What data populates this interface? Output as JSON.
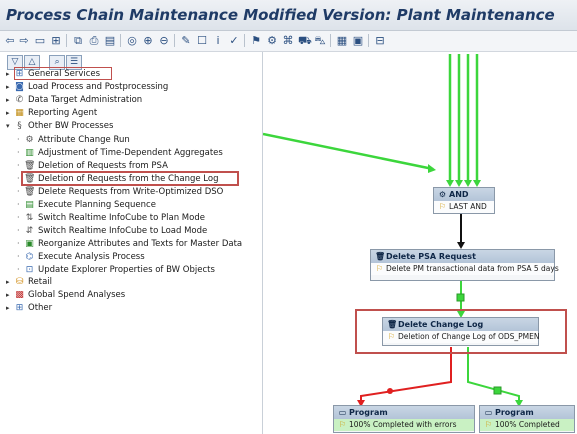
{
  "window": {
    "title": "Process Chain Maintenance Modified Version: Plant Maintenance"
  },
  "toolbar": {
    "icons": [
      "arrow-left",
      "arrow-right",
      "screen",
      "hierarchy",
      "copy",
      "print",
      "find",
      "expand",
      "zoom-in",
      "zoom-out",
      "edit",
      "new",
      "info",
      "check",
      "activate",
      "schedule",
      "network",
      "flag",
      "transport",
      "grid",
      "monitor",
      "layout"
    ]
  },
  "tree": {
    "items": [
      {
        "label": "General Services",
        "icon": "process-icon",
        "arrow": "▸",
        "level": 0
      },
      {
        "label": "Load Process and Postprocessing",
        "icon": "load-icon",
        "arrow": "▸",
        "level": 0
      },
      {
        "label": "Data Target Administration",
        "icon": "target-icon",
        "arrow": "▸",
        "level": 0
      },
      {
        "label": "Reporting Agent",
        "icon": "report-icon",
        "arrow": "▸",
        "level": 0
      },
      {
        "label": "Other BW Processes",
        "icon": "other-icon",
        "arrow": "▾",
        "level": 0
      },
      {
        "label": "Attribute Change Run",
        "icon": "gear-icon",
        "level": 1
      },
      {
        "label": "Adjustment of Time-Dependent Aggregates",
        "icon": "aggregate-icon",
        "level": 1
      },
      {
        "label": "Deletion of Requests from PSA",
        "icon": "trash-icon",
        "level": 1
      },
      {
        "label": "Deletion of Requests from the Change Log",
        "icon": "trash-icon",
        "level": 1
      },
      {
        "label": "Delete Requests from Write-Optimized DSO",
        "icon": "trash-icon",
        "level": 1
      },
      {
        "label": "Execute Planning Sequence",
        "icon": "planning-icon",
        "level": 1
      },
      {
        "label": "Switch Realtime InfoCube to Plan Mode",
        "icon": "switch-icon",
        "level": 1
      },
      {
        "label": "Switch Realtime InfoCube to Load Mode",
        "icon": "switch-icon",
        "level": 1
      },
      {
        "label": "Reorganize Attributes and Texts for Master Data",
        "icon": "reorganize-icon",
        "level": 1
      },
      {
        "label": "Execute Analysis Process",
        "icon": "analysis-icon",
        "level": 1
      },
      {
        "label": "Update Explorer Properties of BW Objects",
        "icon": "explorer-icon",
        "level": 1
      },
      {
        "label": "Retail",
        "icon": "retail-icon",
        "arrow": "▸",
        "level": 0
      },
      {
        "label": "Global Spend Analyses",
        "icon": "spend-icon",
        "arrow": "▸",
        "level": 0
      },
      {
        "label": "Other",
        "icon": "other2-icon",
        "arrow": "▸",
        "level": 0
      }
    ]
  },
  "nodes": {
    "and": {
      "title": "AND",
      "subtitle": "LAST AND"
    },
    "delete_psa": {
      "title": "Delete PSA Request",
      "description": "Delete PM transactional data from PSA 5 days"
    },
    "delete_change_log": {
      "title": "Delete Change Log",
      "description": "Deletion of Change Log of ODS_PMEN"
    },
    "program_errors": {
      "title": "Program",
      "status": "100% Completed with errors"
    },
    "program_ok": {
      "title": "Program",
      "status": "100% Completed"
    }
  },
  "colors": {
    "highlight": "#c0504d",
    "success_line": "#3cd63c",
    "error_line": "#e02020",
    "title_text": "#1f3b66"
  }
}
